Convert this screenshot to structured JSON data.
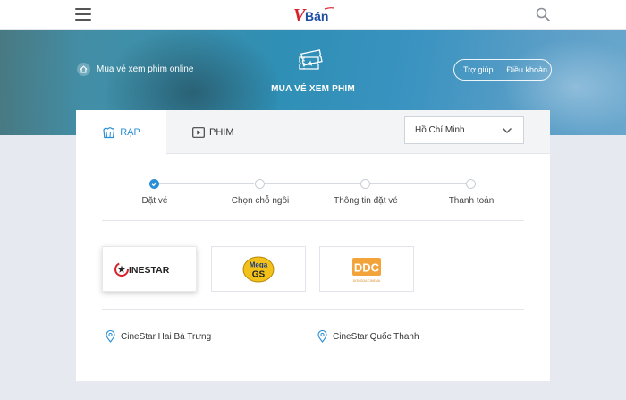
{
  "header": {
    "logo_text": "Bán",
    "logo_letter": "V"
  },
  "banner": {
    "breadcrumb": "Mua vé xem phim online",
    "title": "MUA VÉ XEM PHIM",
    "help_label": "Trợ giúp",
    "terms_label": "Điều khoản"
  },
  "tabs": {
    "rap_label": "RẠP",
    "phim_label": "PHIM"
  },
  "city_select": {
    "value": "Hồ Chí Minh"
  },
  "steps": [
    {
      "label": "Đặt vé",
      "active": true
    },
    {
      "label": "Chọn chỗ ngồi",
      "active": false
    },
    {
      "label": "Thông tin đặt vé",
      "active": false
    },
    {
      "label": "Thanh toán",
      "active": false
    }
  ],
  "cinemas": {
    "cinestar": {
      "name": "CINESTAR",
      "first_letter": "C",
      "rest": "INESTAR"
    },
    "megags": {
      "name": "MegaGS",
      "top": "Mega",
      "bottom": "GS"
    },
    "ddc": {
      "name": "DDC",
      "sub": "DONGDA CINEMA"
    }
  },
  "locations": [
    {
      "name": "CineStar Hai Bà Trưng"
    },
    {
      "name": "CineStar Quốc Thanh"
    }
  ],
  "colors": {
    "accent": "#2a8fd6",
    "logo_red": "#d6202a",
    "logo_blue": "#1f4fa3",
    "mega_yellow": "#f2c21b",
    "ddc_orange": "#f2a33a"
  }
}
